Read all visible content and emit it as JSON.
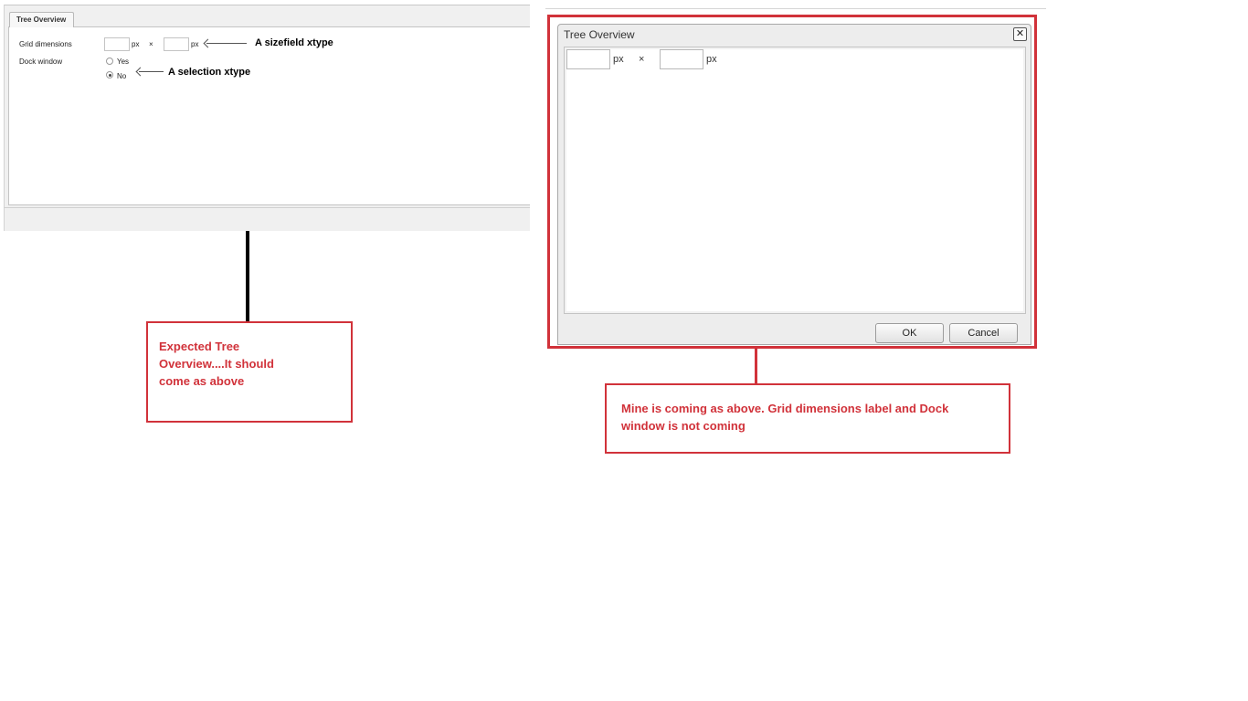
{
  "expected": {
    "tab_label": "Tree Overview",
    "grid_label": "Grid dimensions",
    "dock_label": "Dock window",
    "unit": "px",
    "times": "×",
    "yes_label": "Yes",
    "no_label": "No",
    "selected_option": "No",
    "annotation_sizefield": "A sizefield xtype",
    "annotation_selection": "A selection xtype"
  },
  "expected_note": {
    "line1": "Expected Tree",
    "line2": "Overview....It should",
    "line3": "come as above"
  },
  "actual": {
    "title": "Tree Overview",
    "close_glyph": "✕",
    "unit": "px",
    "times": "×",
    "ok_label": "OK",
    "cancel_label": "Cancel"
  },
  "actual_note": {
    "line1": "Mine is coming as above. Grid dimensions label and Dock",
    "line2": "window is not coming"
  },
  "colors": {
    "annotation_red": "#d1323a",
    "connector_black": "#000000"
  }
}
